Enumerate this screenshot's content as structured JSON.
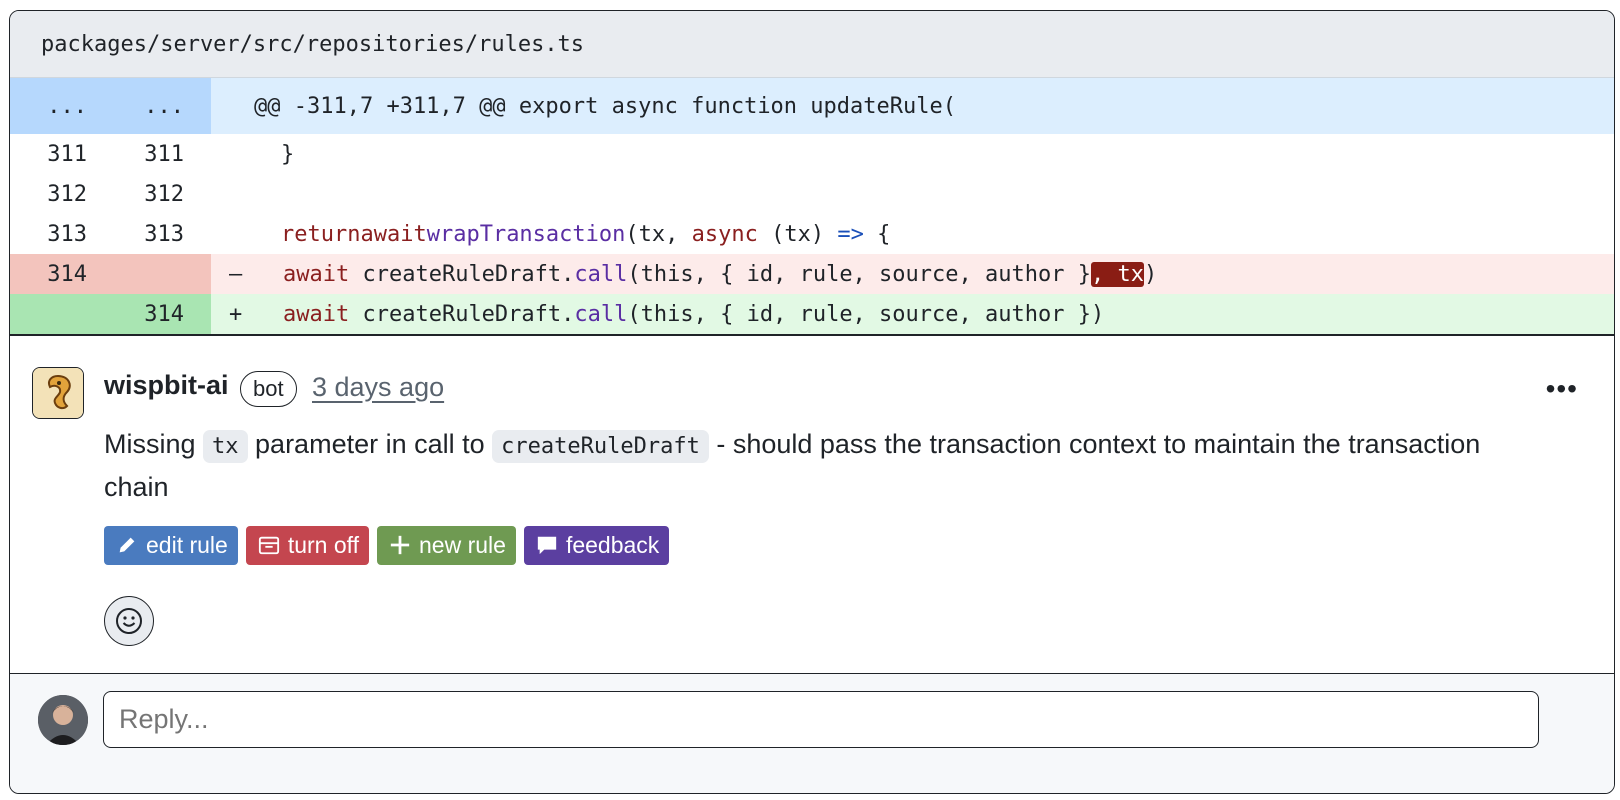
{
  "file": {
    "path": "packages/server/src/repositories/rules.ts"
  },
  "hunk": {
    "old_marker": "...",
    "new_marker": "...",
    "header": "@@ -311,7 +311,7 @@ export async function updateRule("
  },
  "lines": {
    "l311": {
      "old": "311",
      "new": "311",
      "text": "}"
    },
    "l312": {
      "old": "312",
      "new": "312",
      "text": ""
    },
    "l313": {
      "old": "313",
      "new": "313",
      "kw1": "return",
      "kw2": "await",
      "fn": "wrapTransaction",
      "p1": "(tx, ",
      "kw3": "async",
      "p2": " (tx) ",
      "arrow": "=>",
      "p3": " {"
    },
    "del": {
      "old": "314",
      "sign": "–",
      "kw": "await",
      "p1": " createRuleDraft.",
      "fn": "call",
      "p2": "(this, { id, rule, source, author }",
      "hl": ", tx",
      "p3": ")"
    },
    "add": {
      "new": "314",
      "sign": "+",
      "kw": "await",
      "p1": " createRuleDraft.",
      "fn": "call",
      "p2": "(this, { id, rule, source, author })"
    }
  },
  "comment": {
    "author": "wispbit-ai",
    "badge": "bot",
    "time": "3 days ago",
    "more": "•••",
    "body": {
      "t1": "Missing ",
      "c1": "tx",
      "t2": " parameter in call to ",
      "c2": "createRuleDraft",
      "t3": " - should pass the transaction context to maintain the transaction chain"
    },
    "actions": {
      "edit": "edit rule",
      "off": "turn off",
      "new": "new rule",
      "feedback": "feedback"
    }
  },
  "reply": {
    "placeholder": "Reply..."
  },
  "colors": {
    "edit": "#4a7bbf",
    "off": "#c4464f",
    "new": "#6f9a52",
    "feedback": "#5b3fa0"
  }
}
